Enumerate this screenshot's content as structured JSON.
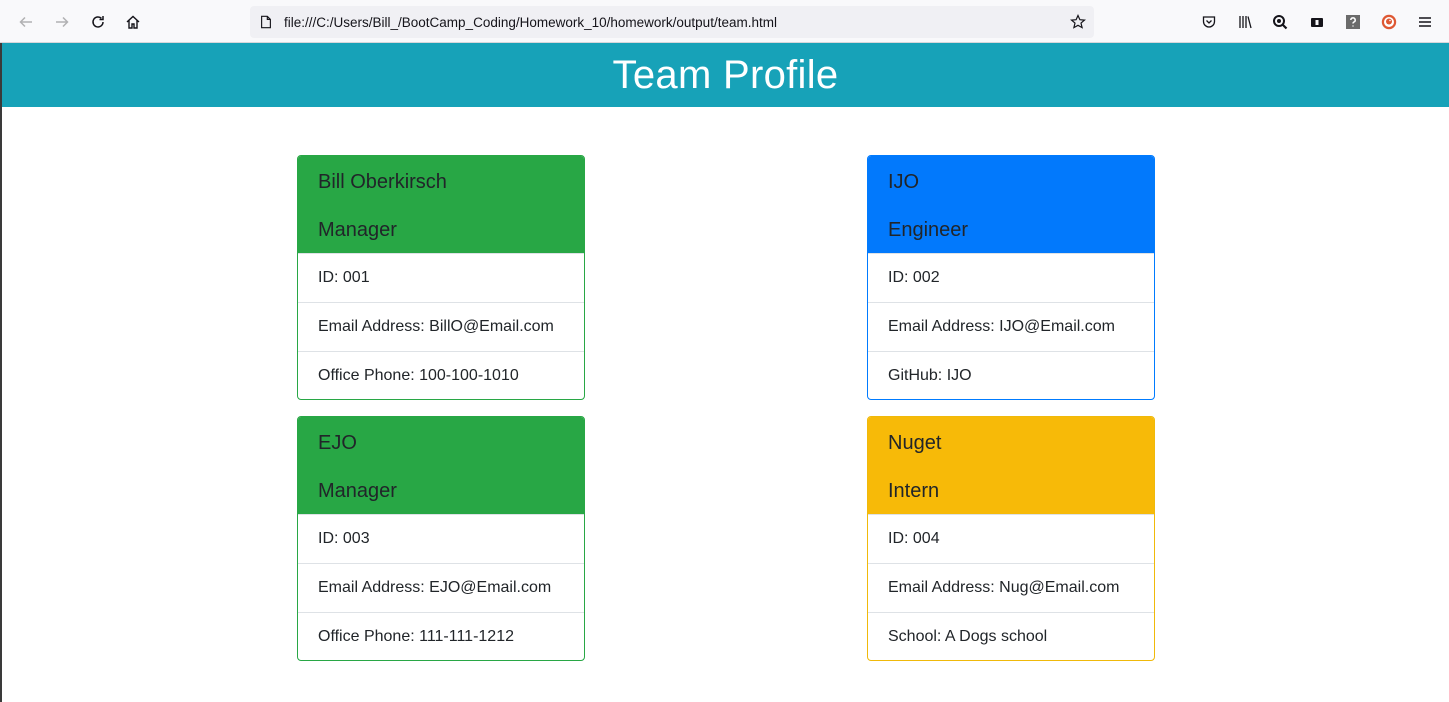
{
  "browser": {
    "url": "file:///C:/Users/Bill_/BootCamp_Coding/Homework_10/homework/output/team.html",
    "icons": [
      "back-icon",
      "forward-icon",
      "reload-icon",
      "home-icon",
      "page-icon",
      "bookmark-star-icon",
      "pocket-icon",
      "library-icon",
      "search-extension-icon",
      "extension-icon",
      "help-extension-icon",
      "duckduckgo-icon",
      "menu-icon"
    ]
  },
  "page": {
    "title": "Team Profile"
  },
  "cards": [
    {
      "name": "Bill Oberkirsch",
      "role": "Manager",
      "rows": [
        "ID: 001",
        "Email Address: BillO@Email.com",
        "Office Phone: 100-100-1010"
      ],
      "color": "#28a745"
    },
    {
      "name": "IJO",
      "role": "Engineer",
      "rows": [
        "ID: 002",
        "Email Address: IJO@Email.com",
        "GitHub: IJO"
      ],
      "color": "#007bff"
    },
    {
      "name": "EJO",
      "role": "Manager",
      "rows": [
        "ID: 003",
        "Email Address: EJO@Email.com",
        "Office Phone: 111-111-1212"
      ],
      "color": "#28a745"
    },
    {
      "name": "Nuget",
      "role": "Intern",
      "rows": [
        "ID: 004",
        "Email Address: Nug@Email.com",
        "School: A Dogs school"
      ],
      "color": "#f7ba08"
    }
  ],
  "colors": {
    "header_bg": "#17a2b8",
    "manager": "#28a745",
    "engineer": "#007bff",
    "intern": "#f7ba08"
  }
}
